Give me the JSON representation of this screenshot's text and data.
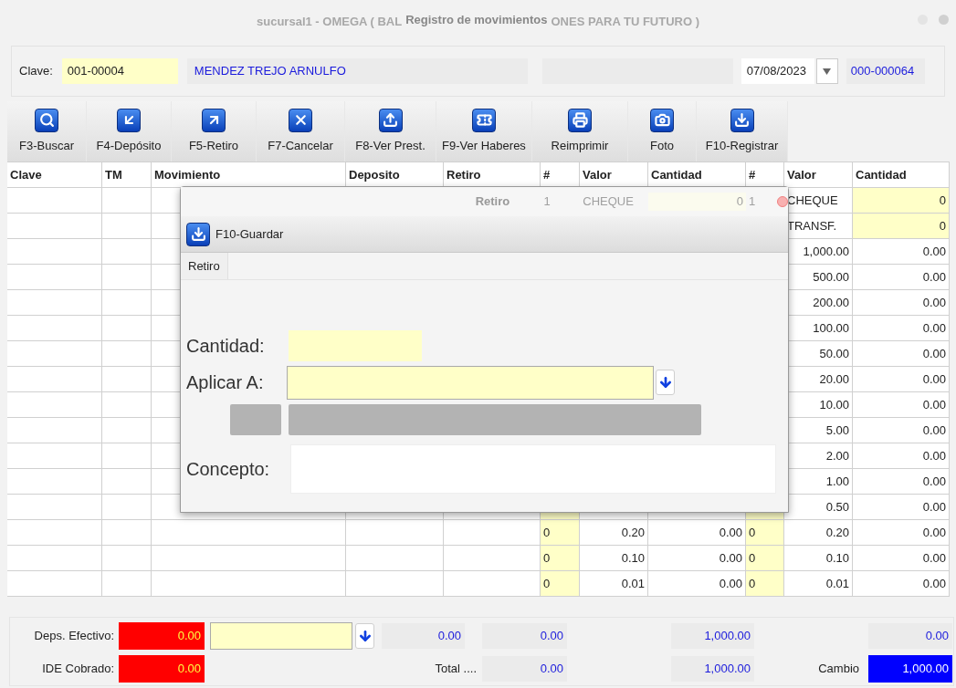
{
  "window": {
    "title": "Registro de movimientos",
    "ghost_title_left": "sucursal1 - OMEGA ( BAL",
    "ghost_title_right": "ONES PARA TU FUTURO )"
  },
  "header": {
    "clave_label": "Clave:",
    "clave": "001-00004",
    "nombre": "MENDEZ TREJO ARNULFO",
    "date": "07/08/2023",
    "folio": "000-000064"
  },
  "toolbar": [
    {
      "label": "F3-Buscar"
    },
    {
      "label": "F4-Depósito"
    },
    {
      "label": "F5-Retiro"
    },
    {
      "label": "F7-Cancelar"
    },
    {
      "label": "F8-Ver Prest."
    },
    {
      "label": "F9-Ver Haberes"
    },
    {
      "label": "Reimprimir"
    },
    {
      "label": "Foto"
    },
    {
      "label": "F10-Registrar"
    }
  ],
  "table": {
    "columns": [
      "Clave",
      "TM",
      "Movimiento",
      "Deposito",
      "Retiro",
      "#",
      "Valor",
      "Cantidad",
      "#",
      "Valor",
      "Cantidad"
    ],
    "rows": [
      {
        "kind": "doc",
        "b_valor": "CHEQUE",
        "b_cantidad": "0"
      },
      {
        "kind": "doc",
        "b_valor": "TRANSF.",
        "b_cantidad": "0"
      },
      {
        "kind": "denom",
        "b_valor": "1,000.00",
        "b_cantidad": "0.00"
      },
      {
        "kind": "denom",
        "b_valor": "500.00",
        "b_cantidad": "0.00"
      },
      {
        "kind": "denom",
        "b_valor": "200.00",
        "b_cantidad": "0.00"
      },
      {
        "kind": "denom",
        "b_valor": "100.00",
        "b_cantidad": "0.00"
      },
      {
        "kind": "denom",
        "b_valor": "50.00",
        "b_cantidad": "0.00"
      },
      {
        "kind": "denom",
        "b_valor": "20.00",
        "b_cantidad": "0.00"
      },
      {
        "kind": "denom",
        "b_valor": "10.00",
        "b_cantidad": "0.00"
      },
      {
        "kind": "denom",
        "b_valor": "5.00",
        "b_cantidad": "0.00"
      },
      {
        "kind": "denom",
        "b_valor": "2.00",
        "b_cantidad": "0.00"
      },
      {
        "kind": "denom",
        "b_valor": "1.00",
        "b_cantidad": "0.00"
      },
      {
        "kind": "denom",
        "b_valor": "0.50",
        "b_cantidad": "0.00"
      },
      {
        "kind": "denom",
        "a_count": "0",
        "a_valor": "0.20",
        "a_cantidad": "0.00",
        "b_count": "0",
        "b_valor": "0.20",
        "b_cantidad": "0.00"
      },
      {
        "kind": "denom",
        "a_count": "0",
        "a_valor": "0.10",
        "a_cantidad": "0.00",
        "b_count": "0",
        "b_valor": "0.10",
        "b_cantidad": "0.00"
      },
      {
        "kind": "denom",
        "a_count": "0",
        "a_valor": "0.01",
        "a_cantidad": "0.00",
        "b_count": "0",
        "b_valor": "0.01",
        "b_cantidad": "0.00"
      }
    ]
  },
  "dialog": {
    "title": "Retiro",
    "ghost_cells": [
      "1",
      "CHEQUE",
      "0",
      "1"
    ],
    "save_button": "F10-Guardar",
    "tabs": [
      {
        "label": "Retiro",
        "selected": true
      }
    ],
    "cantidad_label": "Cantidad:",
    "aplicar_label": "Aplicar A:",
    "concepto_label": "Concepto:"
  },
  "footer": {
    "deps_label": "Deps. Efectivo:",
    "deps_value": "0.00",
    "ide_label": "IDE Cobrado:",
    "ide_value": "0.00",
    "row1_values": [
      "0.00",
      "0.00",
      "1,000.00",
      "0.00"
    ],
    "total_label": "Total ....",
    "total_values": [
      "0.00",
      "1,000.00"
    ],
    "cambio_label": "Cambio",
    "cambio_value": "1,000.00"
  }
}
